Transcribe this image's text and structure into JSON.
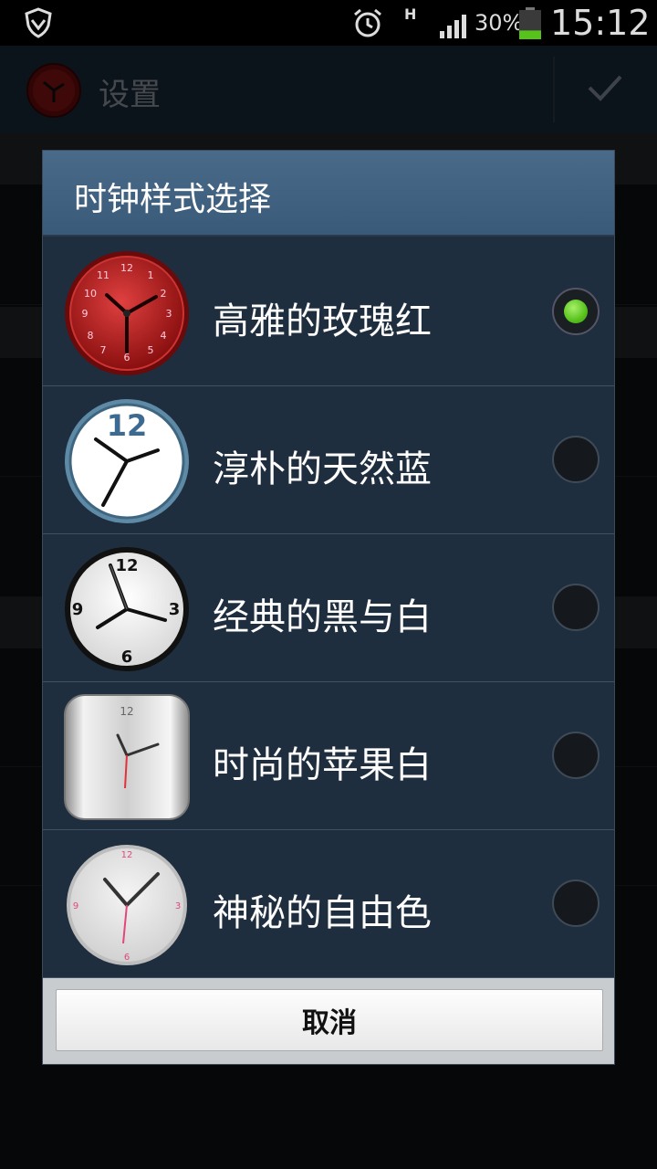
{
  "status_bar": {
    "network_type": "H",
    "battery_percent": "30%",
    "battery_level": 0.3,
    "time": "15:12"
  },
  "action_bar": {
    "title": "设置"
  },
  "dialog": {
    "title": "时钟样式选择",
    "options": [
      {
        "label": "高雅的玫瑰红",
        "selected": true,
        "thumb_icon": "rose-red-clock-icon"
      },
      {
        "label": "淳朴的天然蓝",
        "selected": false,
        "thumb_icon": "natural-blue-clock-icon"
      },
      {
        "label": "经典的黑与白",
        "selected": false,
        "thumb_icon": "black-white-clock-icon"
      },
      {
        "label": "时尚的苹果白",
        "selected": false,
        "thumb_icon": "apple-white-clock-icon"
      },
      {
        "label": "神秘的自由色",
        "selected": false,
        "thumb_icon": "free-color-clock-icon"
      }
    ],
    "cancel_label": "取消"
  },
  "colors": {
    "accent_green": "#58c21c",
    "dialog_bg": "#1e2e3e",
    "title_bar": "#4a6a8a"
  }
}
